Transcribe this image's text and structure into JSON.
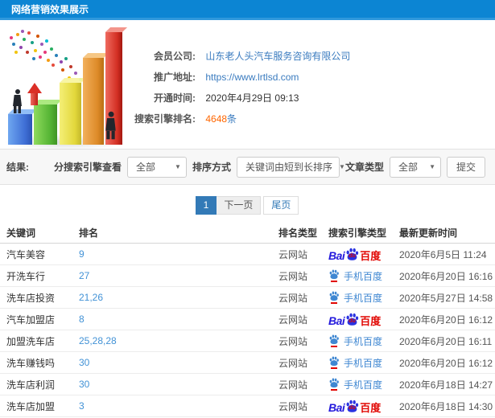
{
  "header": {
    "title": "网络营销效果展示"
  },
  "info": {
    "rows": [
      {
        "label": "会员公司:",
        "value": "山东老人头汽车服务咨询有限公司"
      },
      {
        "label": "推广地址:",
        "value": "https://www.lrtlsd.com"
      },
      {
        "label": "开通时间:",
        "value": "2020年4月29日 09:13"
      },
      {
        "label": "搜索引擎排名:",
        "value": "4648",
        "suffix": "条"
      }
    ]
  },
  "filters": {
    "result_label": "结果:",
    "engine_label": "分搜索引擎查看",
    "engine_value": "全部",
    "sort_label": "排序方式",
    "sort_value": "关键词由短到长排序",
    "article_label": "文章类型",
    "article_value": "全部",
    "submit_label": "提交"
  },
  "pagination": {
    "current": "1",
    "next": "下一页",
    "last": "尾页"
  },
  "table": {
    "headers": [
      "关键词",
      "排名",
      "排名类型",
      "搜索引擎类型",
      "最新更新时间"
    ],
    "engine_labels": {
      "bai": "Bai",
      "du": "du",
      "hanzi": "百度",
      "mobile": "手机百度"
    },
    "rows": [
      {
        "keyword": "汽车美容",
        "rank": "9",
        "rank_type": "云网站",
        "engine": "baidu",
        "time": "2020年6月5日 11:24"
      },
      {
        "keyword": "开洗车行",
        "rank": "27",
        "rank_type": "云网站",
        "engine": "mobile-baidu",
        "time": "2020年6月20日 16:16"
      },
      {
        "keyword": "洗车店投资",
        "rank": "21,26",
        "rank_type": "云网站",
        "engine": "mobile-baidu",
        "time": "2020年5月27日 14:58"
      },
      {
        "keyword": "汽车加盟店",
        "rank": "8",
        "rank_type": "云网站",
        "engine": "baidu",
        "time": "2020年6月20日 16:12"
      },
      {
        "keyword": "加盟洗车店",
        "rank": "25,28,28",
        "rank_type": "云网站",
        "engine": "mobile-baidu",
        "time": "2020年6月20日 16:11"
      },
      {
        "keyword": "洗车赚钱吗",
        "rank": "30",
        "rank_type": "云网站",
        "engine": "mobile-baidu",
        "time": "2020年6月20日 16:12"
      },
      {
        "keyword": "洗车店利润",
        "rank": "30",
        "rank_type": "云网站",
        "engine": "mobile-baidu",
        "time": "2020年6月18日 14:27"
      },
      {
        "keyword": "洗车店加盟",
        "rank": "3",
        "rank_type": "云网站",
        "engine": "baidu",
        "time": "2020年6月18日 14:30"
      }
    ]
  },
  "colors": {
    "header_blue": "#0c85d3",
    "link_blue": "#3a7bbf",
    "highlight_orange": "#ff6600",
    "pagination_active": "#337ab7",
    "baidu_blue": "#2319dc",
    "baidu_red": "#e10602",
    "mobile_blue": "#3f87d2"
  }
}
